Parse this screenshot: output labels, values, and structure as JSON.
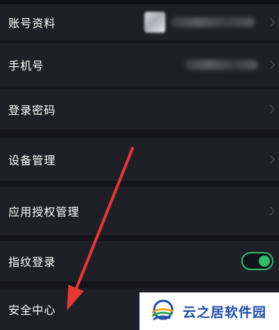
{
  "settings": {
    "rows": {
      "account": {
        "label": "账号资料"
      },
      "phone": {
        "label": "手机号"
      },
      "password": {
        "label": "登录密码"
      },
      "devices": {
        "label": "设备管理"
      },
      "app_auth": {
        "label": "应用授权管理"
      },
      "fingerprint": {
        "label": "指纹登录",
        "toggle_on": true
      },
      "security": {
        "label": "安全中心"
      }
    }
  },
  "annotation": {
    "arrow_color": "#e53935"
  },
  "watermark": {
    "text": "云之居软件园"
  },
  "colors": {
    "toggle_accent": "#2fbf6b",
    "row_bg": "#1f2027",
    "page_bg": "#16161d"
  }
}
